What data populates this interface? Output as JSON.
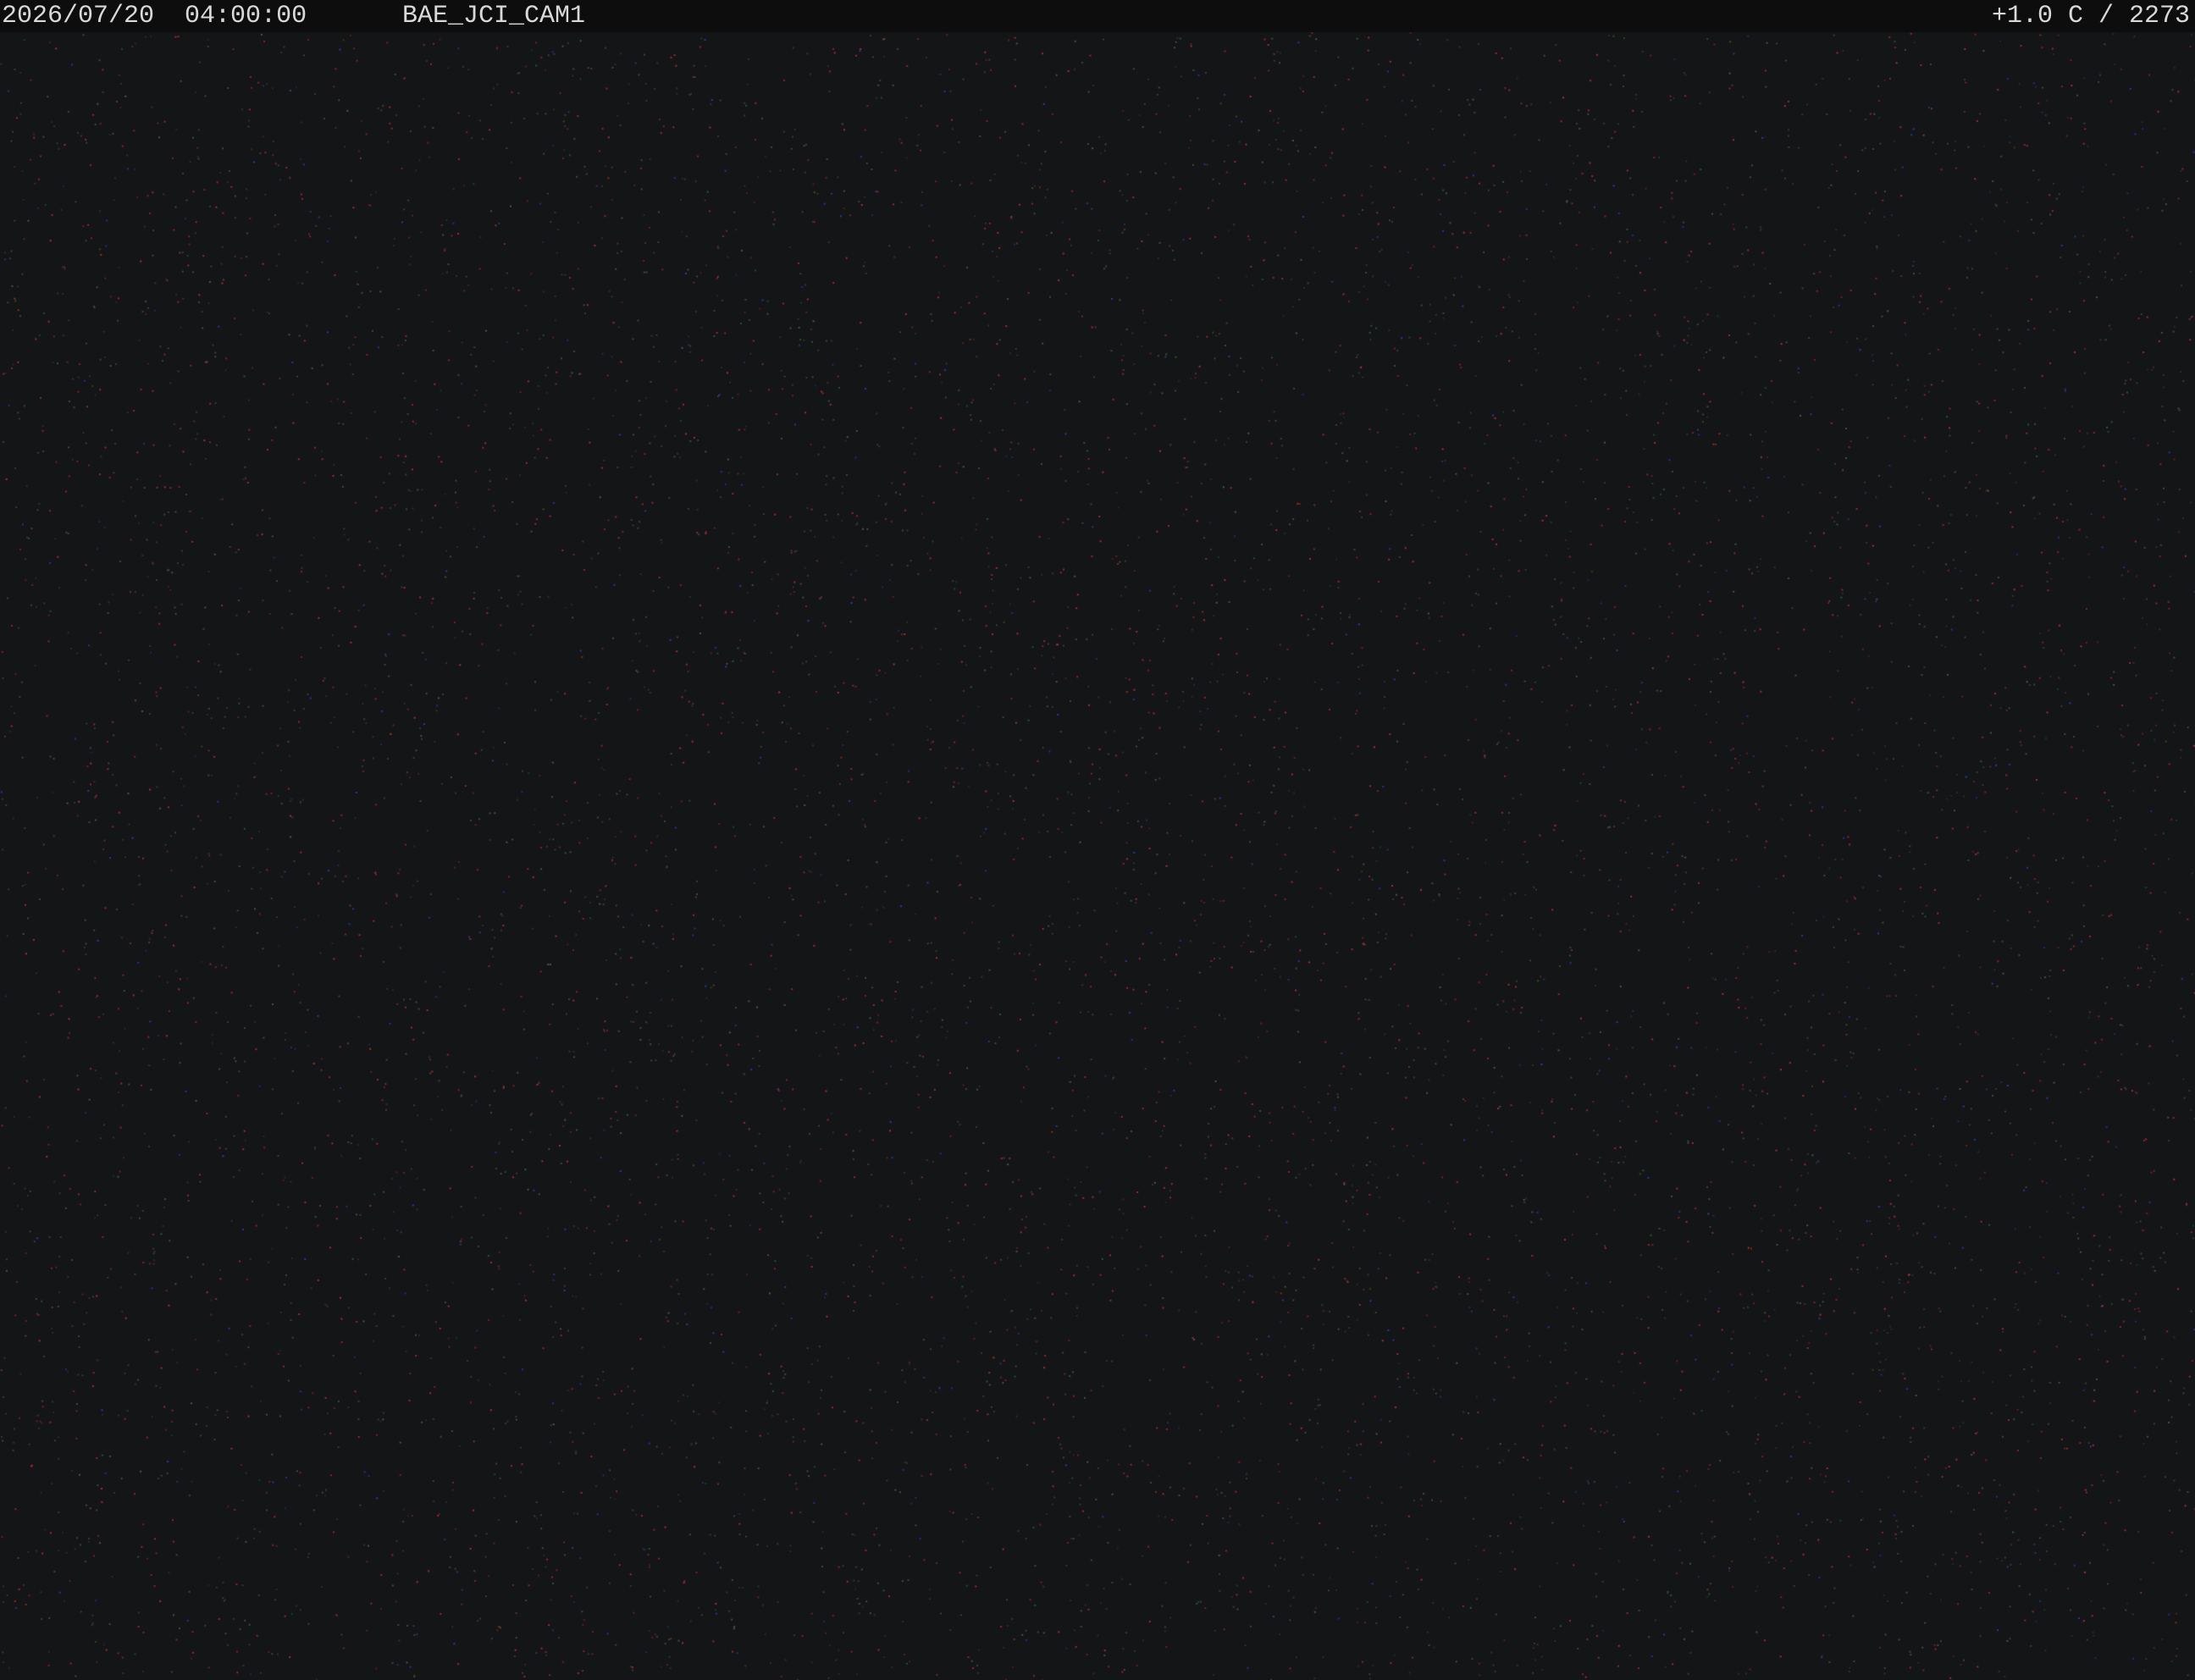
{
  "overlay": {
    "date": "2026/07/20",
    "time": "04:00:00",
    "camera_id": "BAE_JCI_CAM1",
    "readout": "+1.0 C / 2273"
  },
  "colors": {
    "background": "#141516",
    "overlay_bar": "#0d0d0e",
    "overlay_text": "#d9d9d9",
    "noise_red": "#b0303a",
    "noise_green": "#3c5a3c",
    "noise_blue": "#3a3ab0"
  }
}
